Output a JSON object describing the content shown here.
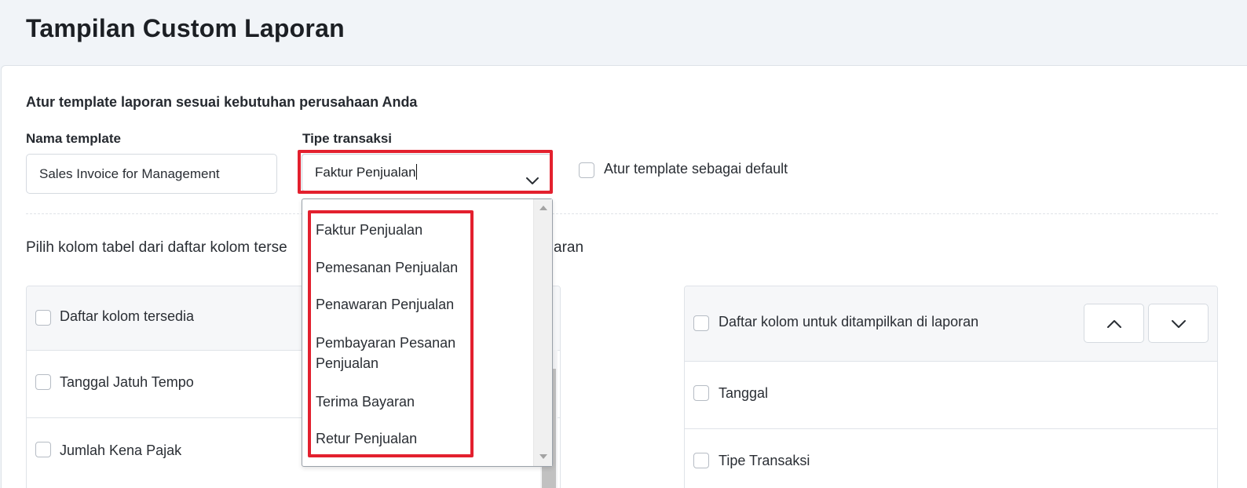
{
  "page": {
    "title": "Tampilan Custom Laporan"
  },
  "form": {
    "subtitle": "Atur template laporan sesuai kebutuhan perusahaan Anda",
    "template_name_label": "Nama template",
    "template_name_value": "Sales Invoice for Management",
    "transaction_type_label": "Tipe transaksi",
    "transaction_type_value": "Faktur Penjualan",
    "default_checkbox_label": "Atur template sebagai default",
    "default_checked": false
  },
  "instruction": {
    "text_left": "Pilih kolom tabel dari daftar kolom terse",
    "text_right": "aran"
  },
  "available_columns": {
    "header": "Daftar kolom tersedia",
    "items": [
      "Tanggal Jatuh Tempo",
      "Jumlah Kena Pajak"
    ]
  },
  "selected_columns": {
    "header": "Daftar kolom untuk ditampilkan di laporan",
    "items": [
      "Tanggal",
      "Tipe Transaksi"
    ],
    "move_up_icon": "chevron-up-icon",
    "move_down_icon": "chevron-down-icon"
  },
  "dropdown": {
    "options": [
      "Faktur Penjualan",
      "Pemesanan Penjualan",
      "Penawaran Penjualan",
      "Pembayaran Pesanan\nPenjualan",
      "Terima Bayaran",
      "Retur Penjualan"
    ]
  },
  "colors": {
    "highlight": "#e3202e",
    "header_bg": "#f1f4f8",
    "panel_head_bg": "#f6f7f9",
    "border": "#dfe3e8"
  }
}
